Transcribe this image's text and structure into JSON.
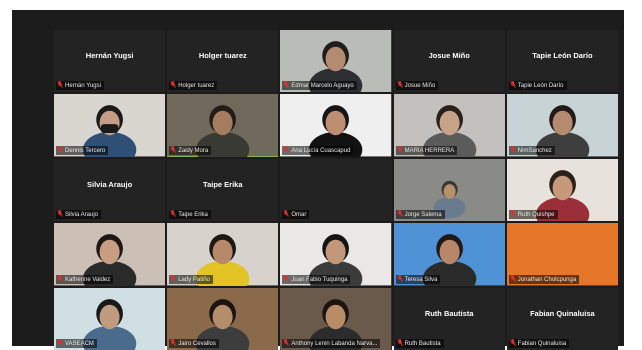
{
  "meeting": {
    "participants": [
      {
        "label": "Hernán Yugsi",
        "display": "Hernán Yugsi",
        "video": false
      },
      {
        "label": "Holger tuarez",
        "display": "Holger tuarez",
        "video": false
      },
      {
        "label": "Edmar Marcelo Aguayo",
        "display": "",
        "video": true,
        "bg": "#b9bcb7",
        "skin": "#b58a6e",
        "shirt": "#2d2f33",
        "hair": "#1e1e1e"
      },
      {
        "label": "Josue Miño",
        "display": "Josue Miño",
        "video": false
      },
      {
        "label": "Tapie León Darío",
        "display": "Tapie León Darío",
        "video": false
      },
      {
        "label": "Dennis Tercero",
        "display": "",
        "video": true,
        "bg": "#d9d6cf",
        "skin": "#c39d85",
        "shirt": "#2f4f77",
        "hair": "#1a1a1a",
        "mask": true
      },
      {
        "label": "Zaidy Mora",
        "display": "",
        "video": true,
        "bg": "#6f6a5c",
        "skin": "#a67c60",
        "shirt": "#3a3a35",
        "hair": "#221d18",
        "active": true
      },
      {
        "label": "Ana Lucía Cuascapud",
        "display": "",
        "video": true,
        "bg": "#efefef",
        "skin": "#bd8e72",
        "shirt": "#121212",
        "hair": "#151515"
      },
      {
        "label": "MARIA HERRERA",
        "display": "",
        "video": true,
        "bg": "#c4c0bd",
        "skin": "#c8a287",
        "shirt": "#5b5b5b",
        "hair": "#2a201b"
      },
      {
        "label": "NimSanchez",
        "display": "",
        "video": true,
        "bg": "#c7d3d5",
        "skin": "#b58b70",
        "shirt": "#3e3e3e",
        "hair": "#221a16"
      },
      {
        "label": "Silvia Araujo",
        "display": "Silvia Araujo",
        "video": false
      },
      {
        "label": "Taipe Erika",
        "display": "Taipe Erika",
        "video": false
      },
      {
        "label": "Omar",
        "display": "",
        "video": false
      },
      {
        "label": "Jorge Salema",
        "display": "",
        "video": true,
        "bg": "#8a8a86",
        "skin": "#b88f6b",
        "shirt": "#6a7a8f",
        "hair": "#3a3630",
        "small": true
      },
      {
        "label": "Ruth Quishpe",
        "display": "",
        "video": true,
        "bg": "#e8e2dc",
        "skin": "#c7997b",
        "shirt": "#9a2f3a",
        "hair": "#2c2119"
      },
      {
        "label": "Katherine Valdez",
        "display": "",
        "video": true,
        "bg": "#cbbfb6",
        "skin": "#c89d82",
        "shirt": "#2a2a2a",
        "hair": "#1c1714"
      },
      {
        "label": "Lady Patiño",
        "display": "",
        "video": true,
        "bg": "#d8d2cc",
        "skin": "#b7896a",
        "shirt": "#e3c426",
        "hair": "#1d1813"
      },
      {
        "label": "Juan Fabio Tuquinga",
        "display": "",
        "video": true,
        "bg": "#e9e8e6",
        "skin": "#c2977a",
        "shirt": "#3b3b3b",
        "hair": "#141414"
      },
      {
        "label": "Teresa Silva",
        "display": "",
        "video": true,
        "bg": "#4f93d6",
        "skin": "#b8876a",
        "shirt": "#2a2a2a",
        "hair": "#1f1a16"
      },
      {
        "label": "Jonathan Cholcpunga",
        "display": "",
        "video": true,
        "bg": "#e6762a",
        "skin": "",
        "shirt": "",
        "hair": "",
        "blank": true
      },
      {
        "label": "VASEACM",
        "display": "",
        "video": true,
        "bg": "#cfdfe3",
        "skin": "#c19b80",
        "shirt": "#4b6b8c",
        "hair": "#191919"
      },
      {
        "label": "Jairo Cevallos",
        "display": "",
        "video": true,
        "bg": "#8b6a4c",
        "skin": "#b58c6c",
        "shirt": "#3d3d3d",
        "hair": "#1b1410"
      },
      {
        "label": "Anthony Lenin Labanda Narva...",
        "display": "",
        "video": true,
        "bg": "#6a5a4c",
        "skin": "#b98b67",
        "shirt": "#2c2c2c",
        "hair": "#1b1511"
      },
      {
        "label": "Ruth Bautista",
        "display": "Ruth Bautista",
        "video": false
      },
      {
        "label": "Fabian Quinaluisa",
        "display": "Fabian Quinaluisa",
        "video": false
      }
    ]
  },
  "colors": {
    "mic_muted": "#e0302b",
    "active_border": "#9be24a",
    "tile_bg": "#232323"
  }
}
